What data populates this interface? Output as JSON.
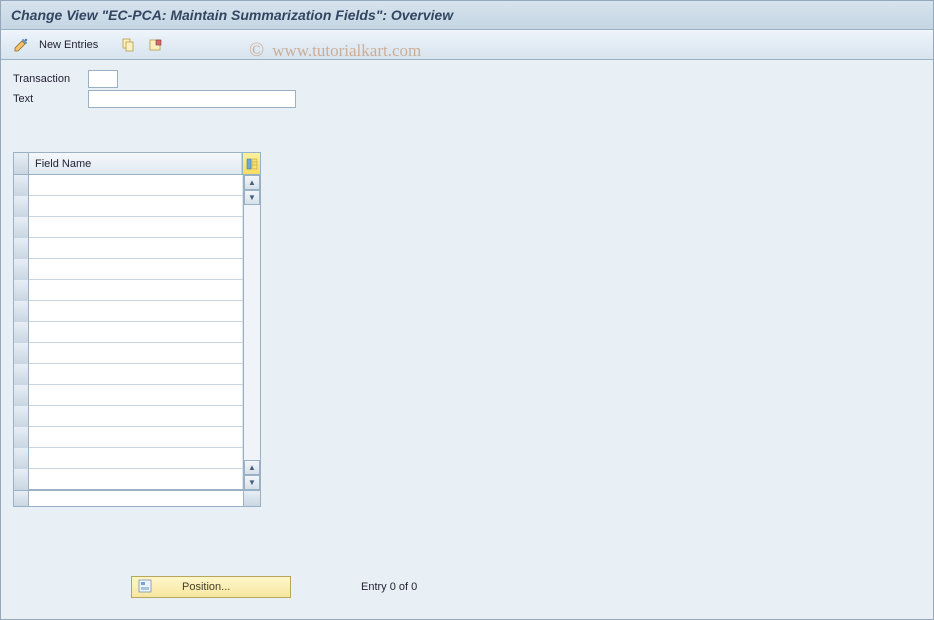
{
  "title": "Change View \"EC-PCA: Maintain Summarization Fields\": Overview",
  "toolbar": {
    "new_entries_label": "New Entries"
  },
  "form": {
    "transaction_label": "Transaction",
    "transaction_value": "",
    "text_label": "Text",
    "text_value": ""
  },
  "grid": {
    "column_header": "Field Name",
    "rows": [
      "",
      "",
      "",
      "",
      "",
      "",
      "",
      "",
      "",
      "",
      "",
      "",
      "",
      "",
      ""
    ]
  },
  "footer": {
    "position_label": "Position...",
    "entry_label": "Entry 0 of 0"
  },
  "watermark": {
    "copy": "©",
    "text": "www.tutorialkart.com"
  }
}
